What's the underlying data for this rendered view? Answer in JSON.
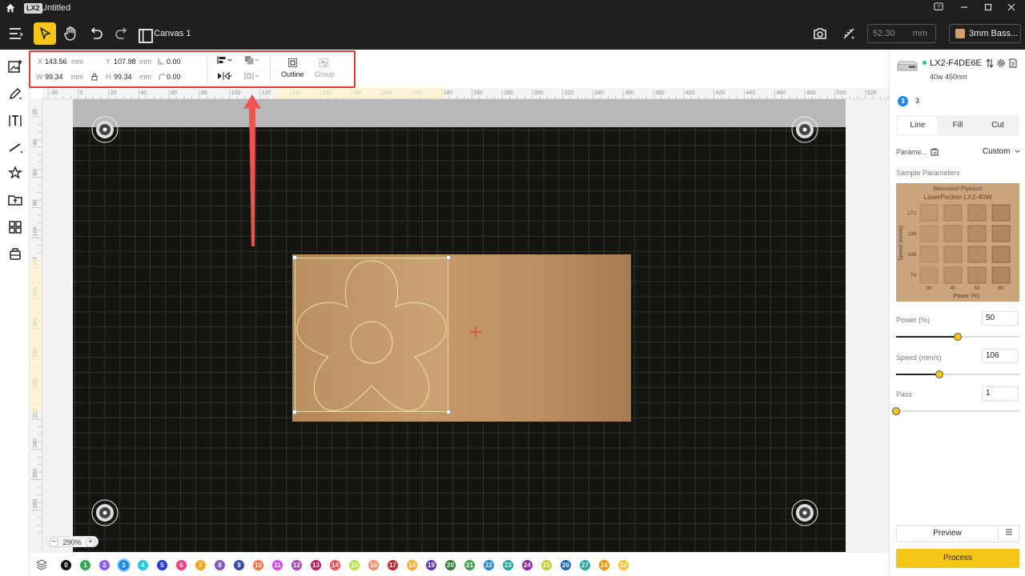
{
  "titlebar": {
    "app_badge": "LX2",
    "doc_title": "Untitled"
  },
  "toolbar": {
    "canvas_name": "Canvas 1",
    "power_value": "52.30",
    "power_unit": "mm",
    "material_label": "3mm Bass..."
  },
  "props": {
    "x_label": "X",
    "x_value": "143.56",
    "x_unit": "mm",
    "y_label": "Y",
    "y_value": "107.98",
    "y_unit": "mm",
    "w_label": "W",
    "w_value": "99.34",
    "w_unit": "mm",
    "h_label": "H",
    "h_value": "99.34",
    "h_unit": "mm",
    "angle_value": "0.00",
    "radius_value": "0.00",
    "outline_label": "Outline",
    "group_label": "Group"
  },
  "ruler": {
    "top_ticks": [
      "-20",
      "0",
      "20",
      "40",
      "60",
      "80",
      "100",
      "120",
      "140",
      "160",
      "180",
      "200",
      "220",
      "240",
      "260",
      "280",
      "300",
      "320",
      "340",
      "360",
      "380",
      "400",
      "420",
      "440",
      "460",
      "480",
      "500",
      "520"
    ],
    "left_ticks": [
      "20",
      "40",
      "60",
      "80",
      "100",
      "120",
      "140",
      "160",
      "180",
      "200",
      "220",
      "240",
      "260",
      "280"
    ]
  },
  "zoom": {
    "level": "290%",
    "minus": "−",
    "plus": "+"
  },
  "layers": [
    "0",
    "1",
    "2",
    "3",
    "4",
    "5",
    "6",
    "7",
    "8",
    "9",
    "10",
    "11",
    "12",
    "13",
    "14",
    "15",
    "16",
    "17",
    "18",
    "19",
    "20",
    "21",
    "22",
    "23",
    "24",
    "25",
    "26",
    "27",
    "28",
    "29"
  ],
  "layer_colors": [
    "#111111",
    "#2eaa4f",
    "#8a5cf6",
    "#1e88e5",
    "#26c6da",
    "#283bd6",
    "#ec407a",
    "#f5a623",
    "#7e57c2",
    "#3949ab",
    "#ff7043",
    "#e040fb",
    "#ab47bc",
    "#c2185b",
    "#ef5350",
    "#b2e34a",
    "#ff8a65",
    "#c62828",
    "#ffa726",
    "#5e35b1",
    "#2e7d32",
    "#43a047",
    "#1e88e5",
    "#26a69a",
    "#8e24aa",
    "#c0ca33",
    "#1565c0",
    "#26a69a",
    "#fb8c00",
    "#fbc02d"
  ],
  "device": {
    "name": "LX2-F4DE6E",
    "spec": "40w 450nm"
  },
  "layer_panel": {
    "current_layer": "3",
    "current_layer_text": "3",
    "tabs": [
      "Line",
      "Fill",
      "Cut"
    ],
    "params_label": "Parame...",
    "params_mode": "Custom",
    "sample_label": "Sample Parameters",
    "sample_title_1": "Basswood Plywood",
    "sample_title_2": "LaserPecker LX2-40W",
    "sample_axis_y": "Speed (mm/s)",
    "sample_axis_x": "Power (%)",
    "sample_y_ticks": [
      "171",
      "139",
      "106",
      "74"
    ],
    "sample_x_ticks": [
      "30",
      "40",
      "50",
      "60"
    ],
    "power_label": "Power (%)",
    "power_value": "50",
    "power_frac": 0.5,
    "speed_label": "Speed (mm/s)",
    "speed_value": "106",
    "speed_frac": 0.35,
    "pass_label": "Pass",
    "pass_value": "1",
    "pass_frac": 0.0,
    "preview_label": "Preview",
    "process_label": "Process"
  }
}
